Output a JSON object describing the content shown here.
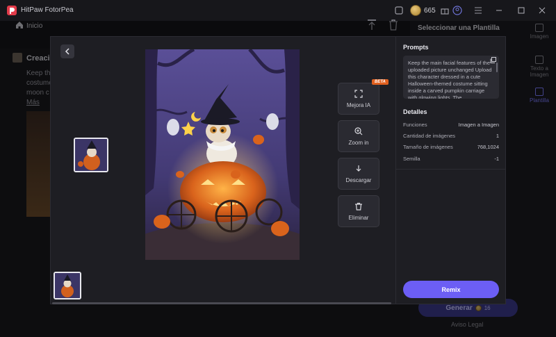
{
  "app": {
    "title": "HitPaw FotorPea",
    "coin_count": "665"
  },
  "nav": {
    "home_label": "Inicio"
  },
  "background": {
    "section_title": "Creació",
    "lines": [
      "Keep th",
      "costume",
      "moon c"
    ],
    "link": "Más",
    "right_heading": "Seleccionar una Plantilla",
    "generate_label": "Generar",
    "generate_cost": "16",
    "aviso": "Aviso Legal"
  },
  "rail": {
    "items": [
      {
        "label": "Imagen"
      },
      {
        "label": "Texto a Imagen"
      },
      {
        "label": "Plantilla"
      }
    ]
  },
  "actions": {
    "beta": "BETA",
    "enhance": "Mejora IA",
    "zoom": "Zoom in",
    "download": "Descargar",
    "delete": "Eliminar"
  },
  "details": {
    "prompts_title": "Prompts",
    "prompt_text": "Keep the main facial features of the uploaded picture unchanged Upload this character dressed in a cute Halloween-themed costume sitting inside a carved pumpkin carriage with glowing lights. The",
    "title": "Detalles",
    "rows": [
      {
        "label": "Funciones",
        "value": "Imagen a Imagen"
      },
      {
        "label": "Cantidad de imágenes",
        "value": "1"
      },
      {
        "label": "Tamaño de imágenes",
        "value": "768,1024"
      },
      {
        "label": "Semilla",
        "value": "-1"
      }
    ],
    "remix_label": "Remix"
  },
  "colors": {
    "accent": "#6c5ef5",
    "beta": "#e0601f"
  }
}
